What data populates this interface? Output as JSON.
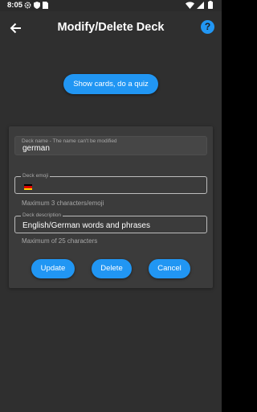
{
  "status_bar": {
    "time": "8:05"
  },
  "app_bar": {
    "title": "Modify/Delete Deck",
    "help_icon_text": "?"
  },
  "quiz_button": {
    "label": "Show cards, do a quiz"
  },
  "form": {
    "deck_name": {
      "label": "Deck name - The name can't be modified",
      "value": "german"
    },
    "deck_emoji": {
      "label": "Deck emoji",
      "value": "🇩🇪",
      "helper": "Maximum 3 characters/emoji"
    },
    "deck_description": {
      "label": "Deck description",
      "value": "English/German words and phrases",
      "helper": "Maximum of 25 characters"
    }
  },
  "actions": {
    "update": "Update",
    "delete": "Delete",
    "cancel": "Cancel"
  },
  "colors": {
    "accent": "#2196f3",
    "background": "#2f2f2f",
    "card": "#3b3b3b"
  },
  "icons": [
    "settings-icon",
    "shield-icon",
    "sim-icon",
    "wifi-icon",
    "signal-icon",
    "battery-icon",
    "back-arrow-icon",
    "help-icon",
    "german-flag-icon"
  ]
}
